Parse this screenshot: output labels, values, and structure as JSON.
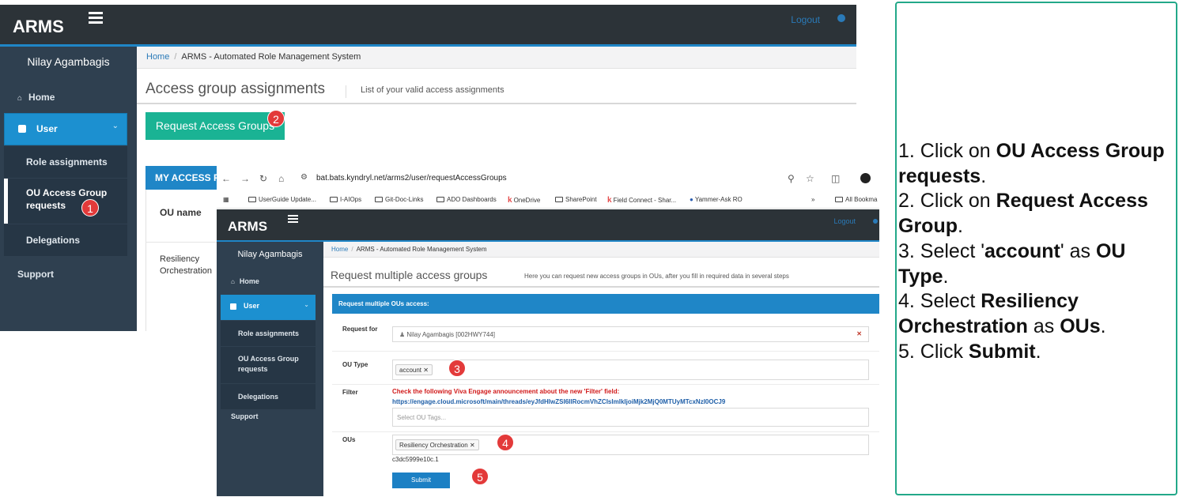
{
  "back": {
    "brand": "ARMS",
    "logout": "Logout",
    "user_name": "Nilay Agambagis",
    "nav": {
      "home": "Home",
      "user": "User",
      "role_assignments": "Role assignments",
      "ou_access_group_requests": "OU Access Group requests",
      "delegations": "Delegations",
      "support": "Support"
    },
    "breadcrumb": {
      "home": "Home",
      "current": "ARMS - Automated Role Management System"
    },
    "page_title": "Access group assignments",
    "page_subtitle": "List of your valid access assignments",
    "request_button": "Request Access Groups",
    "panel_title": "MY ACCESS R",
    "table": {
      "column": "OU name",
      "first_cell": "Resiliency Orchestration"
    }
  },
  "browser": {
    "url": "bat.bats.kyndryl.net/arms2/user/requestAccessGroups",
    "bookmarks": [
      "UserGuide Update...",
      "I-AIOps",
      "Git-Doc-Links",
      "ADO Dashboards",
      "OneDrive",
      "SharePoint",
      "Field Connect - Shar...",
      "Yammer-Ask RO"
    ],
    "bookmarks_more": "»",
    "all_bookmarks": "All Bookma"
  },
  "front": {
    "brand": "ARMS",
    "logout": "Logout",
    "user_name": "Nilay Agambagis",
    "nav": {
      "home": "Home",
      "user": "User",
      "role_assignments": "Role assignments",
      "ou_access_group_requests": "OU Access Group requests",
      "delegations": "Delegations",
      "support": "Support"
    },
    "breadcrumb": {
      "home": "Home",
      "current": "ARMS - Automated Role Management System"
    },
    "page_title": "Request multiple access groups",
    "page_subtitle": "Here you can request new access groups in OUs, after you fill in required data in several steps",
    "panel_title": "Request multiple OUs access:",
    "form": {
      "request_for_label": "Request for",
      "request_for_value": "Nilay Agambagis [002HWY744]",
      "ou_type_label": "OU Type",
      "ou_type_tag": "account",
      "filter_label": "Filter",
      "filter_warning": "Check the following Viva Engage announcement about the new 'Filter' field:",
      "filter_link": "https://engage.cloud.microsoft/main/threads/eyJfdHlwZSI6IlRocmVhZCIsImlkIjoiMjk2MjQ0MTUyMTcxNzI0OCJ9",
      "filter_placeholder": "Select OU Tags...",
      "ous_label": "OUs",
      "ous_tag": "Resiliency Orchestration",
      "ous_id": "c3dc5999e10c.1",
      "submit": "Submit"
    }
  },
  "badges": [
    "1",
    "2",
    "3",
    "4",
    "5"
  ],
  "instructions": {
    "s1_prefix": "1. Click on ",
    "s1_bold": "OU Access Group requests",
    "s1_suffix": ".",
    "s2_prefix": "2. Click on ",
    "s2_bold": "Request Access Group",
    "s2_suffix": ".",
    "s3_prefix": "3. Select '",
    "s3_bold": "account",
    "s3_mid": "' as ",
    "s3_bold2": "OU Type",
    "s3_suffix": ".",
    "s4_prefix": "4. Select ",
    "s4_bold": "Resiliency Orchestration",
    "s4_mid": " as ",
    "s4_bold2": "OUs",
    "s4_suffix": ".",
    "s5_prefix": "5. Click ",
    "s5_bold": "Submit",
    "s5_suffix": "."
  },
  "colors": {
    "nav_dark": "#2f4050",
    "topbar": "#2c3338",
    "primary_blue": "#1c90d0",
    "teal_button": "#1ab394",
    "badge_red": "#e33a3a",
    "instruction_border": "#23a889"
  }
}
